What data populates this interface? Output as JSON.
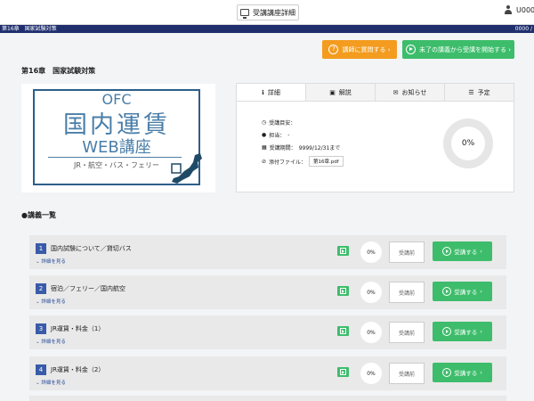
{
  "header": {
    "page_title": "受講講座詳細",
    "user_name": "U000"
  },
  "navbar": {
    "left": "第16章　国家試験対策",
    "right": "0000 /"
  },
  "actions": {
    "ask_label": "講師に質問する ›",
    "start_label": "未了の講義から受講を開始する ›"
  },
  "course": {
    "title": "第16章　国家試験対策"
  },
  "logo": {
    "line1": "OFC",
    "line2": "国内運賃",
    "line3": "WEB講座",
    "line4": "JR・航空・バス・フェリー"
  },
  "tabs": [
    {
      "label": "詳細"
    },
    {
      "label": "解説"
    },
    {
      "label": "お知らせ"
    },
    {
      "label": "予定"
    }
  ],
  "details": {
    "target_label": "受講目安：",
    "teacher_label": "担当：",
    "teacher_value": "-",
    "period_label": "受講期間：",
    "period_value": "9999/12/31まで",
    "file_label": "添付ファイル：",
    "file_name": "第16章.pdf",
    "progress": "0%"
  },
  "lecture_section_title": "●講義一覧",
  "lectures": [
    {
      "num": "1",
      "title": "国内試験について／貸切バス",
      "more": "詳細を見る",
      "progress": "0%",
      "status": "受講前",
      "button": "受講する"
    },
    {
      "num": "2",
      "title": "宿泊／フェリー／国内航空",
      "more": "詳細を見る",
      "progress": "0%",
      "status": "受講前",
      "button": "受講する"
    },
    {
      "num": "3",
      "title": "JR運賃・料金（1）",
      "more": "詳細を見る",
      "progress": "0%",
      "status": "受講前",
      "button": "受講する"
    },
    {
      "num": "4",
      "title": "JR運賃・料金（2）",
      "more": "詳細を見る",
      "progress": "0%",
      "status": "受講前",
      "button": "受講する"
    }
  ],
  "colors": {
    "navy": "#1f2f6e",
    "orange": "#f39c1f",
    "green": "#3dbd6b",
    "number_blue": "#3a5ba8"
  }
}
